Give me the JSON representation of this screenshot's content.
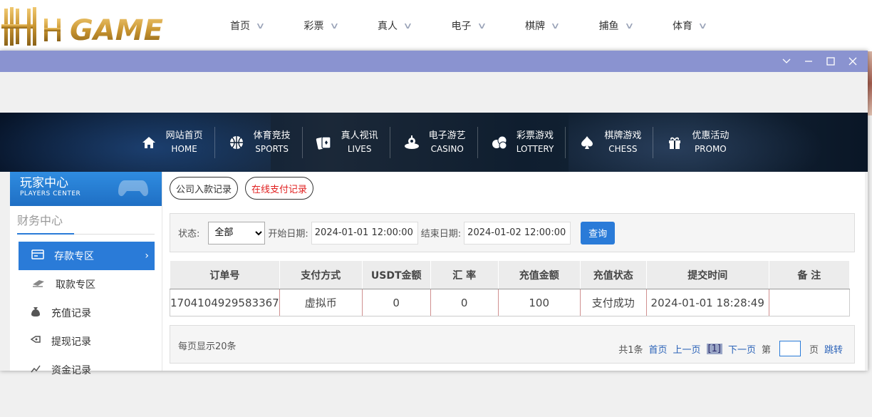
{
  "logo": {
    "text": "HH GAME"
  },
  "top_nav": [
    {
      "label": "首页"
    },
    {
      "label": "彩票"
    },
    {
      "label": "真人"
    },
    {
      "label": "电子"
    },
    {
      "label": "棋牌"
    },
    {
      "label": "捕鱼"
    },
    {
      "label": "体育"
    }
  ],
  "window_controls": {
    "collapse": "chevron-down-icon",
    "minimize": "minimize-icon",
    "maximize": "maximize-icon",
    "close": "close-icon"
  },
  "main_nav": [
    {
      "zh": "网站首页",
      "en": "HOME",
      "icon": "home-icon"
    },
    {
      "zh": "体育竞技",
      "en": "SPORTS",
      "icon": "basketball-icon"
    },
    {
      "zh": "真人视讯",
      "en": "LIVES",
      "icon": "cards-icon"
    },
    {
      "zh": "电子游艺",
      "en": "CASINO",
      "icon": "slot-icon"
    },
    {
      "zh": "彩票游戏",
      "en": "LOTTERY",
      "icon": "lottery-balls-icon"
    },
    {
      "zh": "棋牌游戏",
      "en": "CHESS",
      "icon": "spade-icon"
    },
    {
      "zh": "优惠活动",
      "en": "PROMO",
      "icon": "gift-icon"
    }
  ],
  "sidebar": {
    "title_zh": "玩家中心",
    "title_en": "PLAYERS CENTER",
    "section": "财务中心",
    "items": [
      {
        "label": "存款专区",
        "active": true,
        "icon": "card-icon"
      },
      {
        "label": "取款专区",
        "active": false,
        "icon": "cash-icon"
      },
      {
        "label": "充值记录",
        "active": false,
        "icon": "money-bag-icon"
      },
      {
        "label": "提现记录",
        "active": false,
        "icon": "withdraw-icon"
      },
      {
        "label": "资金记录",
        "active": false,
        "icon": "chart-icon"
      }
    ]
  },
  "tabs": [
    {
      "label": "公司入款记录",
      "active": false
    },
    {
      "label": "在线支付记录",
      "active": true
    }
  ],
  "filter": {
    "status_label": "状态:",
    "status_value": "全部",
    "start_label": "开始日期:",
    "start_value": "2024-01-01 12:00:00",
    "end_label": "结束日期:",
    "end_value": "2024-01-02 12:00:00",
    "query_button": "查询"
  },
  "table": {
    "headers": [
      "订单号",
      "支付方式",
      "USDT金额",
      "汇 率",
      "充值金额",
      "充值状态",
      "提交时间",
      "备 注"
    ],
    "rows": [
      [
        "1704104929583367",
        "虚拟币",
        "0",
        "0",
        "100",
        "支付成功",
        "2024-01-01 18:28:49",
        ""
      ]
    ]
  },
  "pager": {
    "per_page": "每页显示20条",
    "total": "共1条",
    "first": "首页",
    "prev": "上一页",
    "current": "[1]",
    "next": "下一页",
    "page_prefix": "第",
    "page_suffix": "页",
    "jump": "跳转"
  }
}
